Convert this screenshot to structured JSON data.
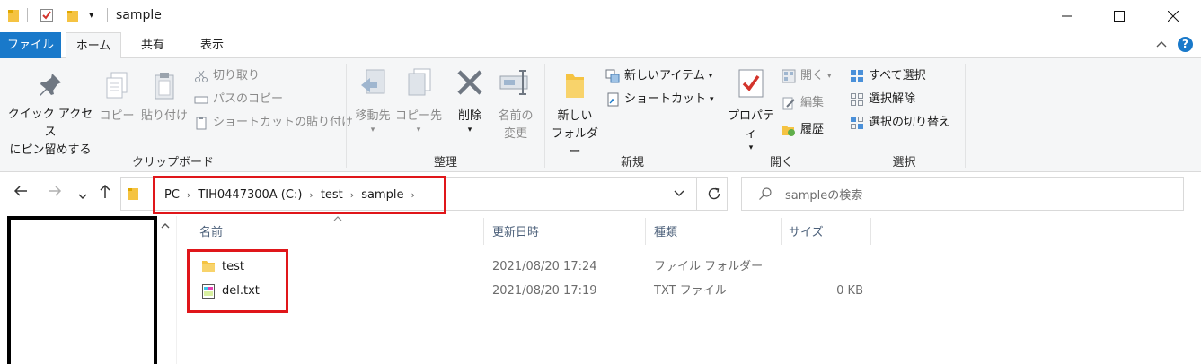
{
  "window": {
    "title": "sample",
    "quick_access_dropdown": "▾"
  },
  "tabs": [
    {
      "label": "ファイル"
    },
    {
      "label": "ホーム"
    },
    {
      "label": "共有"
    },
    {
      "label": "表示"
    }
  ],
  "ribbon": {
    "clipboard": {
      "label": "クリップボード",
      "pin_line1": "クイック アクセス",
      "pin_line2": "にピン留めする",
      "copy": "コピー",
      "paste": "貼り付け",
      "cut": "切り取り",
      "copy_path": "パスのコピー",
      "paste_shortcut": "ショートカットの貼り付け"
    },
    "organize": {
      "label": "整理",
      "move_to": "移動先",
      "copy_to": "コピー先",
      "delete": "削除",
      "rename_line1": "名前の",
      "rename_line2": "変更"
    },
    "new": {
      "label": "新規",
      "new_folder_line1": "新しい",
      "new_folder_line2": "フォルダー",
      "new_item": "新しいアイテム",
      "shortcut": "ショートカット"
    },
    "open": {
      "label": "開く",
      "properties": "プロパティ",
      "open": "開く",
      "edit": "編集",
      "history": "履歴"
    },
    "select": {
      "label": "選択",
      "select_all": "すべて選択",
      "select_none": "選択解除",
      "invert": "選択の切り替え"
    }
  },
  "address": {
    "crumbs": [
      "PC",
      "TIH0447300A (C:)",
      "test",
      "sample"
    ]
  },
  "search": {
    "placeholder": "sampleの検索"
  },
  "list": {
    "columns": [
      "名前",
      "更新日時",
      "種類",
      "サイズ"
    ],
    "rows": [
      {
        "name": "test",
        "modified": "2021/08/20 17:24",
        "type": "ファイル フォルダー",
        "size": ""
      },
      {
        "name": "del.txt",
        "modified": "2021/08/20 17:19",
        "type": "TXT ファイル",
        "size": "0 KB"
      }
    ]
  },
  "colors": {
    "accent": "#1979ca",
    "highlight": "#e0161a",
    "folder": "#f5c342"
  }
}
